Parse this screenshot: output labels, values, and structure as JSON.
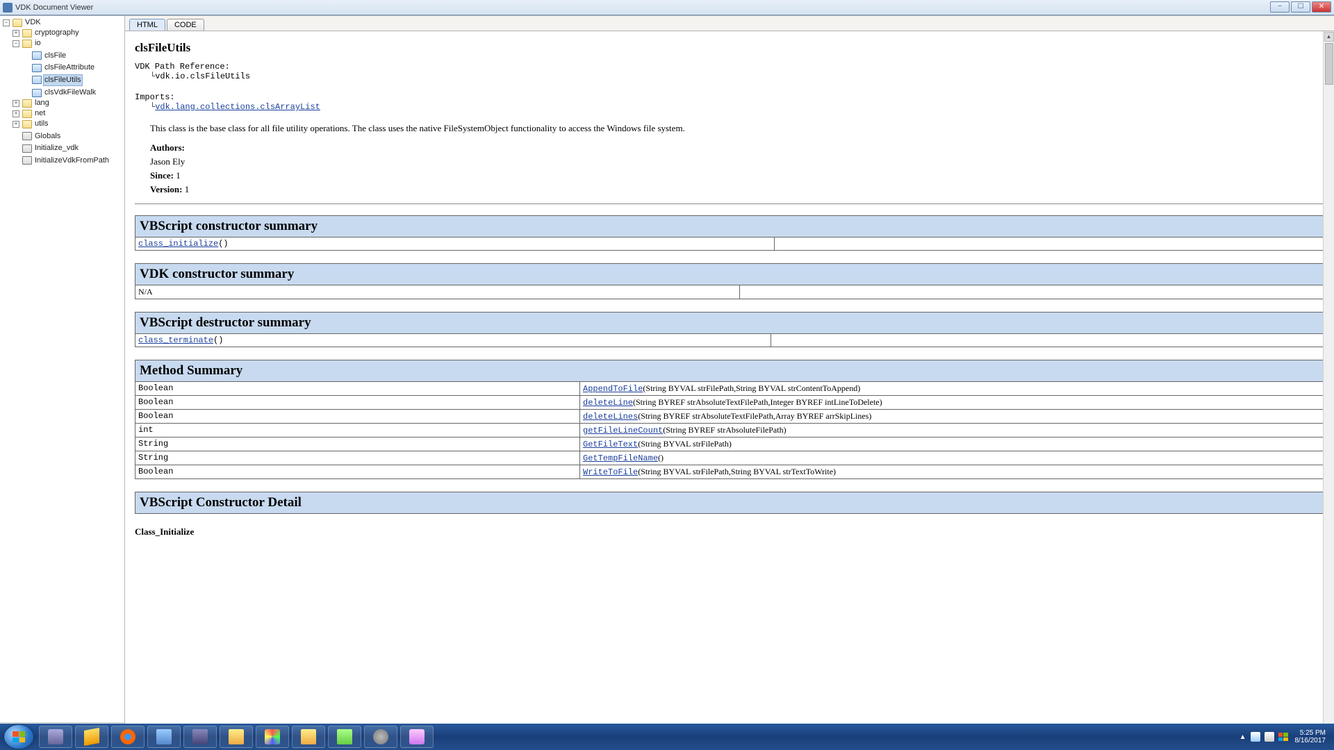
{
  "window": {
    "title": "VDK Document Viewer"
  },
  "tree": {
    "root": "VDK",
    "nodes": {
      "cryptography": "cryptography",
      "io": "io",
      "clsFile": "clsFile",
      "clsFileAttribute": "clsFileAttribute",
      "clsFileUtils": "clsFileUtils",
      "clsVdkFileWalk": "clsVdkFileWalk",
      "lang": "lang",
      "net": "net",
      "utils": "utils",
      "Globals": "Globals",
      "Initialize_vdk": "Initialize_vdk",
      "InitializeVdkFromPath": "InitializeVdkFromPath"
    }
  },
  "tabs": {
    "html": "HTML",
    "code": "CODE"
  },
  "doc": {
    "class_title": "clsFileUtils",
    "path_label": "VDK Path Reference:",
    "path_value": "vdk.io.clsFileUtils",
    "imports_label": "Imports:",
    "imports_value": "vdk.lang.collections.clsArrayList",
    "description": "This class is the base class for all file utility operations. The class uses the native FileSystemObject functionality to access the Windows file system.",
    "authors_label": "Authors:",
    "author_name": "Jason Ely",
    "since_label": "Since:",
    "since_value": "1",
    "version_label": "Version:",
    "version_value": "1"
  },
  "sections": {
    "vbs_ctor_summary": "VBScript constructor summary",
    "vdk_ctor_summary": "VDK constructor summary",
    "vbs_dtor_summary": "VBScript destructor summary",
    "method_summary": "Method Summary",
    "vbs_ctor_detail": "VBScript Constructor Detail"
  },
  "ctor": {
    "name": "class_initialize",
    "sig": "()"
  },
  "vdk_ctor": {
    "na": "N/A"
  },
  "dtor": {
    "name": "class_terminate",
    "sig": "()"
  },
  "methods": [
    {
      "ret": "Boolean",
      "name": "AppendToFile",
      "params": "(String BYVAL strFilePath,String BYVAL strContentToAppend)"
    },
    {
      "ret": "Boolean",
      "name": "deleteLine",
      "params": "(String BYREF strAbsoluteTextFilePath,Integer BYREF intLineToDelete)"
    },
    {
      "ret": "Boolean",
      "name": "deleteLines",
      "params": "(String BYREF strAbsoluteTextFilePath,Array BYREF arrSkipLines)"
    },
    {
      "ret": "int",
      "name": "getFileLineCount",
      "params": "(String BYREF strAbsoluteFilePath)"
    },
    {
      "ret": "String",
      "name": "GetFileText",
      "params": "(String BYVAL strFilePath)"
    },
    {
      "ret": "String",
      "name": "GetTempFileName",
      "params": "()"
    },
    {
      "ret": "Boolean",
      "name": "WriteToFile",
      "params": "(String BYVAL strFilePath,String BYVAL strTextToWrite)"
    }
  ],
  "detail": {
    "class_init": "Class_Initialize"
  },
  "taskbar": {
    "time": "5:25 PM",
    "date": "8/16/2017"
  }
}
